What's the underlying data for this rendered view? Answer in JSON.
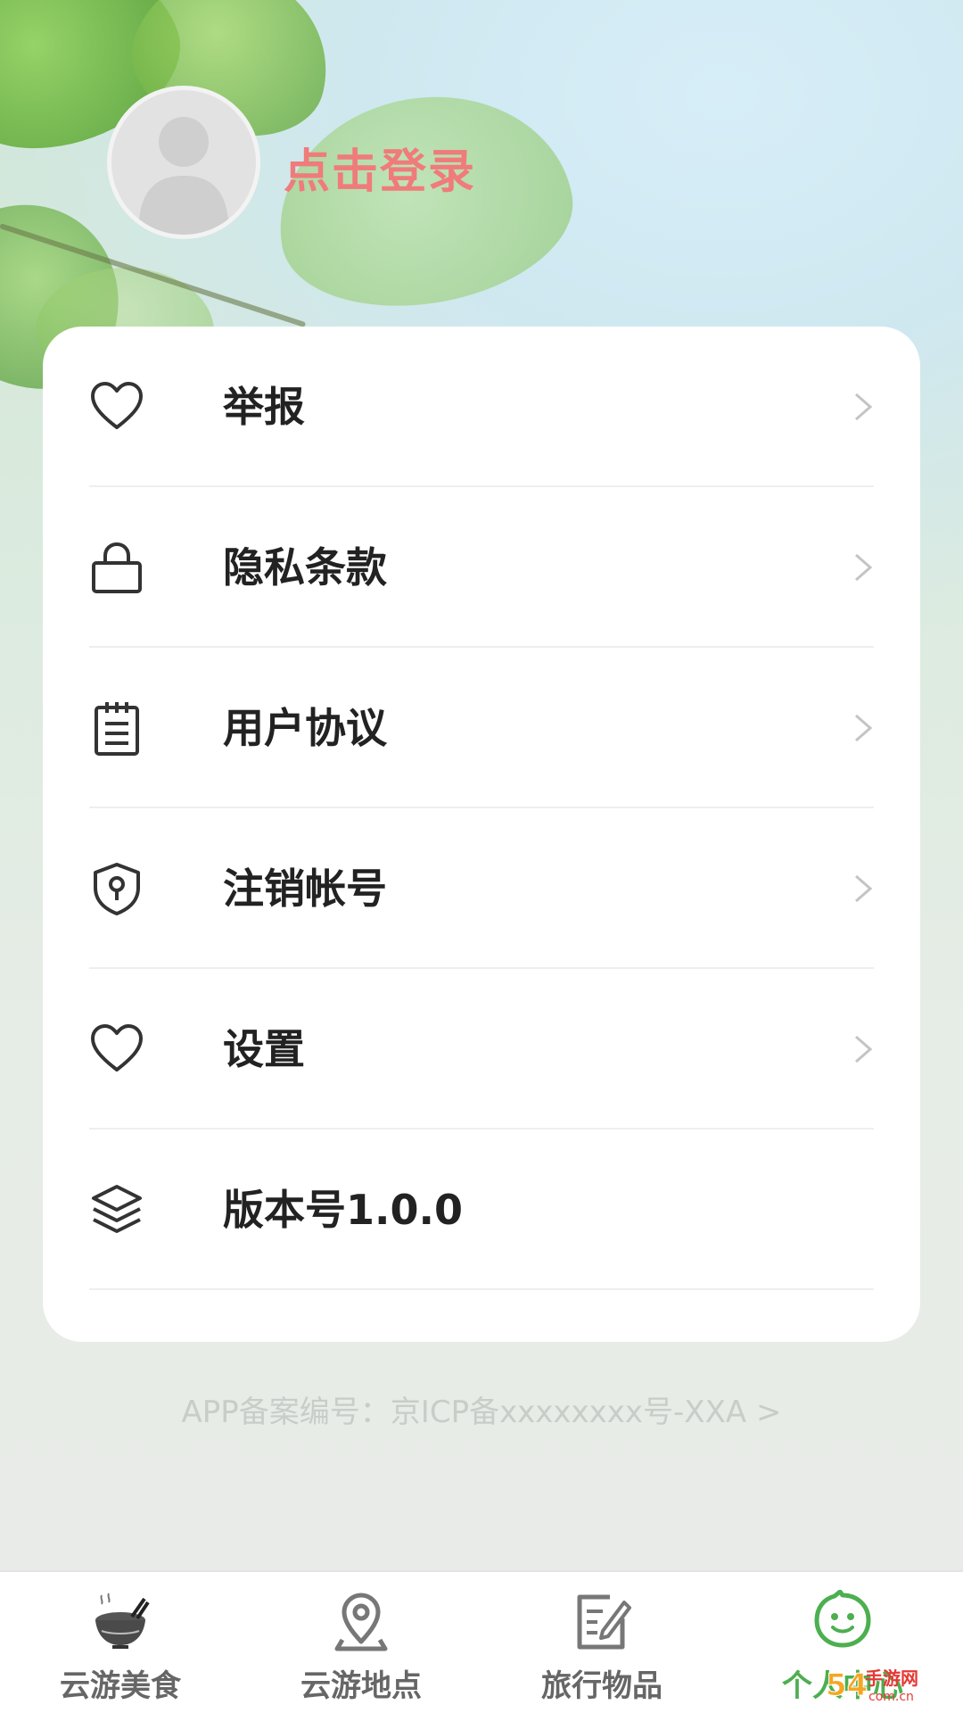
{
  "header": {
    "login_label": "点击登录"
  },
  "menu": {
    "items": [
      {
        "label": "举报",
        "icon": "heart-icon"
      },
      {
        "label": "隐私条款",
        "icon": "lock-icon"
      },
      {
        "label": "用户协议",
        "icon": "notepad-icon"
      },
      {
        "label": "注销帐号",
        "icon": "shield-keyhole-icon"
      },
      {
        "label": "设置",
        "icon": "heart-icon"
      },
      {
        "label": "版本号1.0.0",
        "icon": "layers-icon"
      }
    ]
  },
  "footer": {
    "icp_text": "APP备案编号：京ICP备xxxxxxxx号-XXA >"
  },
  "tabbar": {
    "tabs": [
      {
        "label": "云游美食",
        "icon": "noodle-bowl-icon",
        "active": false
      },
      {
        "label": "云游地点",
        "icon": "map-pin-icon",
        "active": false
      },
      {
        "label": "旅行物品",
        "icon": "edit-note-icon",
        "active": false
      },
      {
        "label": "个人中心",
        "icon": "smile-bubble-icon",
        "active": true
      }
    ],
    "active_color": "#4caf50",
    "inactive_color": "#666666"
  },
  "watermark": {
    "text": "54手游网 com.cn"
  },
  "colors": {
    "login_text": "#f07b7b",
    "card_bg": "#ffffff",
    "label_text": "#222222",
    "divider": "#eeeeee"
  }
}
